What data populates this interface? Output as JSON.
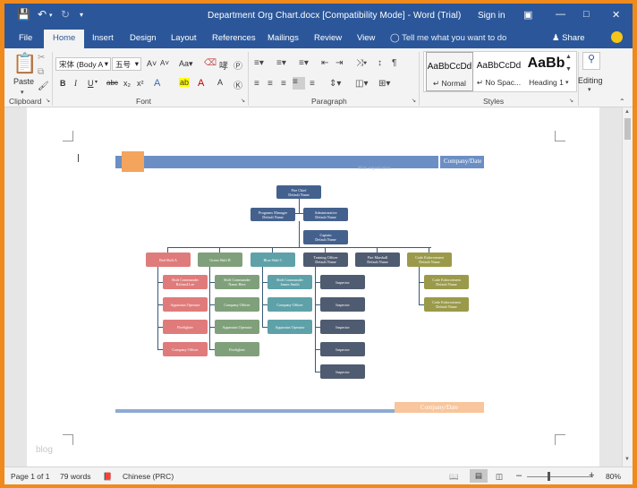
{
  "titlebar": {
    "doc_title": "Department Org Chart.docx [Compatibility Mode]  -  Word (Trial)",
    "sign_in": "Sign in"
  },
  "tabs": [
    "File",
    "Home",
    "Insert",
    "Design",
    "Layout",
    "References",
    "Mailings",
    "Review",
    "View"
  ],
  "tell_me": "Tell me what you want to do",
  "share": "Share",
  "ribbon": {
    "clipboard": {
      "paste": "Paste",
      "label": "Clipboard"
    },
    "font": {
      "family": "宋体 (Body A",
      "size": "五号",
      "label": "Font"
    },
    "paragraph": {
      "label": "Paragraph"
    },
    "styles": {
      "label": "Styles",
      "items": [
        {
          "sample": "AaBbCcDd",
          "name": "↵ Normal"
        },
        {
          "sample": "AaBbCcDd",
          "name": "↵ No Spac..."
        },
        {
          "sample": "AaBb",
          "name": "Heading 1"
        }
      ]
    },
    "editing": "Editing"
  },
  "document": {
    "header_date": "Company/Date",
    "header_faded": "Main organization",
    "footer_date": "Company/Date",
    "watermark": "blog"
  },
  "org": {
    "chief": [
      "Fire Chief",
      "Default Name"
    ],
    "pm": [
      "Programs Manager",
      "Default Name"
    ],
    "admin": [
      "Administrative",
      "Default Name"
    ],
    "captain": [
      "Captain",
      "Default Name"
    ],
    "columns": [
      {
        "head": "Red Shift A",
        "color": "#e07b7b",
        "items": [
          [
            "Shift Commander",
            "Richard Lee"
          ],
          [
            "Apparatus Operator"
          ],
          [
            "Firefighter"
          ],
          [
            "Company Officer"
          ]
        ]
      },
      {
        "head": "Green Shift B",
        "color": "#7fa07a",
        "items": [
          [
            "Shift Commander",
            "Name Here"
          ],
          [
            "Company Officer"
          ],
          [
            "Apparatus Operator"
          ],
          [
            "Firefighter"
          ]
        ]
      },
      {
        "head": "Blue Shift C",
        "color": "#5ea1a8",
        "items": [
          [
            "Shift Commander",
            "James Smith"
          ],
          [
            "Company Officer"
          ],
          [
            "Apparatus Operator"
          ]
        ]
      },
      {
        "head": "Training Officer",
        "head2": "Default Name",
        "color": "#4f5b70",
        "items": [
          [
            "Inspector"
          ],
          [
            "Inspector"
          ],
          [
            "Inspector"
          ],
          [
            "Inspector"
          ],
          [
            "Inspector"
          ]
        ]
      },
      {
        "head": "Fire Marshall",
        "head2": "Default Name",
        "color": "#4f5b70",
        "items": []
      },
      {
        "head": "Code Enforcement",
        "head2": "Default Name",
        "color": "#9a9a4a",
        "items": [
          [
            "Code Enforcement",
            "Default Name"
          ],
          [
            "Code Enforcement",
            "Default Name"
          ]
        ]
      }
    ]
  },
  "status": {
    "page": "Page 1 of 1",
    "words": "79 words",
    "language": "Chinese (PRC)",
    "zoom": "80%"
  },
  "colors": {
    "word_blue": "#2b579a",
    "frame_orange": "#f08a1c"
  }
}
